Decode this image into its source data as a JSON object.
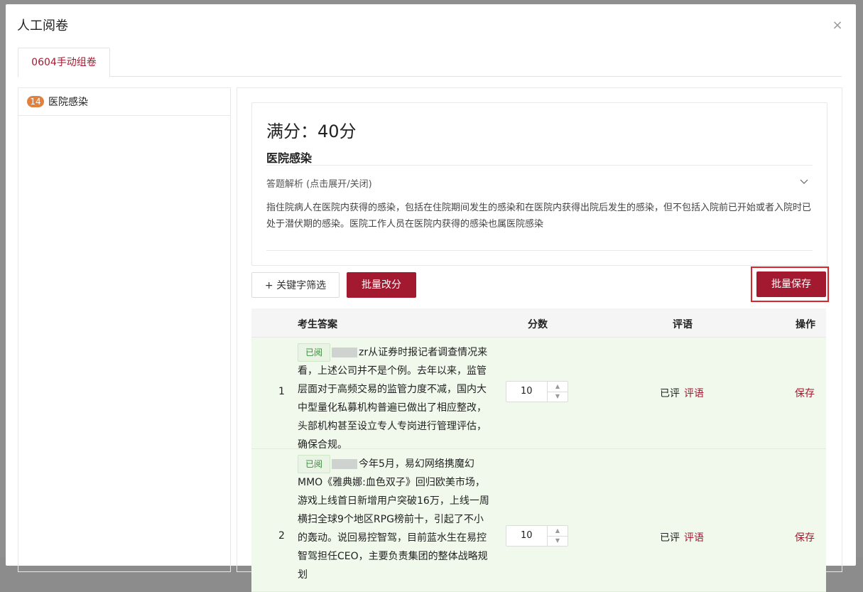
{
  "modal": {
    "title": "人工阅卷",
    "close_icon": "×"
  },
  "tabs": [
    {
      "label": "0604手动组卷"
    }
  ],
  "sidebar": {
    "items": [
      {
        "count": "14",
        "label": "医院感染"
      }
    ]
  },
  "question": {
    "full_score": "满分：40分",
    "title": "医院感染",
    "analysis_toggle": "答题解析 (点击展开/关闭)",
    "analysis_text": "指住院病人在医院内获得的感染，包括在住院期间发生的感染和在医院内获得出院后发生的感染，但不包括入院前已开始或者入院时已处于潜伏期的感染。医院工作人员在医院内获得的感染也属医院感染"
  },
  "toolbar": {
    "keyword_filter": "+ 关键字筛选",
    "batch_score": "批量改分",
    "batch_save": "批量保存"
  },
  "table": {
    "headers": {
      "answer": "考生答案",
      "score": "分数",
      "comment": "评语",
      "action": "操作"
    },
    "rows": [
      {
        "index": "1",
        "status_tag": "已阅",
        "answer": "zr从证券时报记者调查情况来看，上述公司并不是个例。去年以来，监管层面对于高频交易的监管力度不减，国内大中型量化私募机构普遍已做出了相应整改，头部机构甚至设立专人专岗进行管理评估，确保合规。",
        "score": "10",
        "comment_status": "已评",
        "comment_link": "评语",
        "action": "保存"
      },
      {
        "index": "2",
        "status_tag": "已阅",
        "answer": "今年5月，易幻网络携魔幻MMO《雅典娜:血色双子》回归欧美市场，游戏上线首日新增用户突破16万，上线一周横扫全球9个地区RPG榜前十，引起了不小的轰动。说回易控智驾，目前蓝水生在易控智驾担任CEO，主要负责集团的整体战略规划",
        "score": "10",
        "comment_status": "已评",
        "comment_link": "评语",
        "action": "保存"
      }
    ]
  },
  "colors": {
    "accent": "#a3192f",
    "badge": "#e0823e",
    "row_bg": "#f0f9ec",
    "highlight_border": "#d9262c"
  }
}
